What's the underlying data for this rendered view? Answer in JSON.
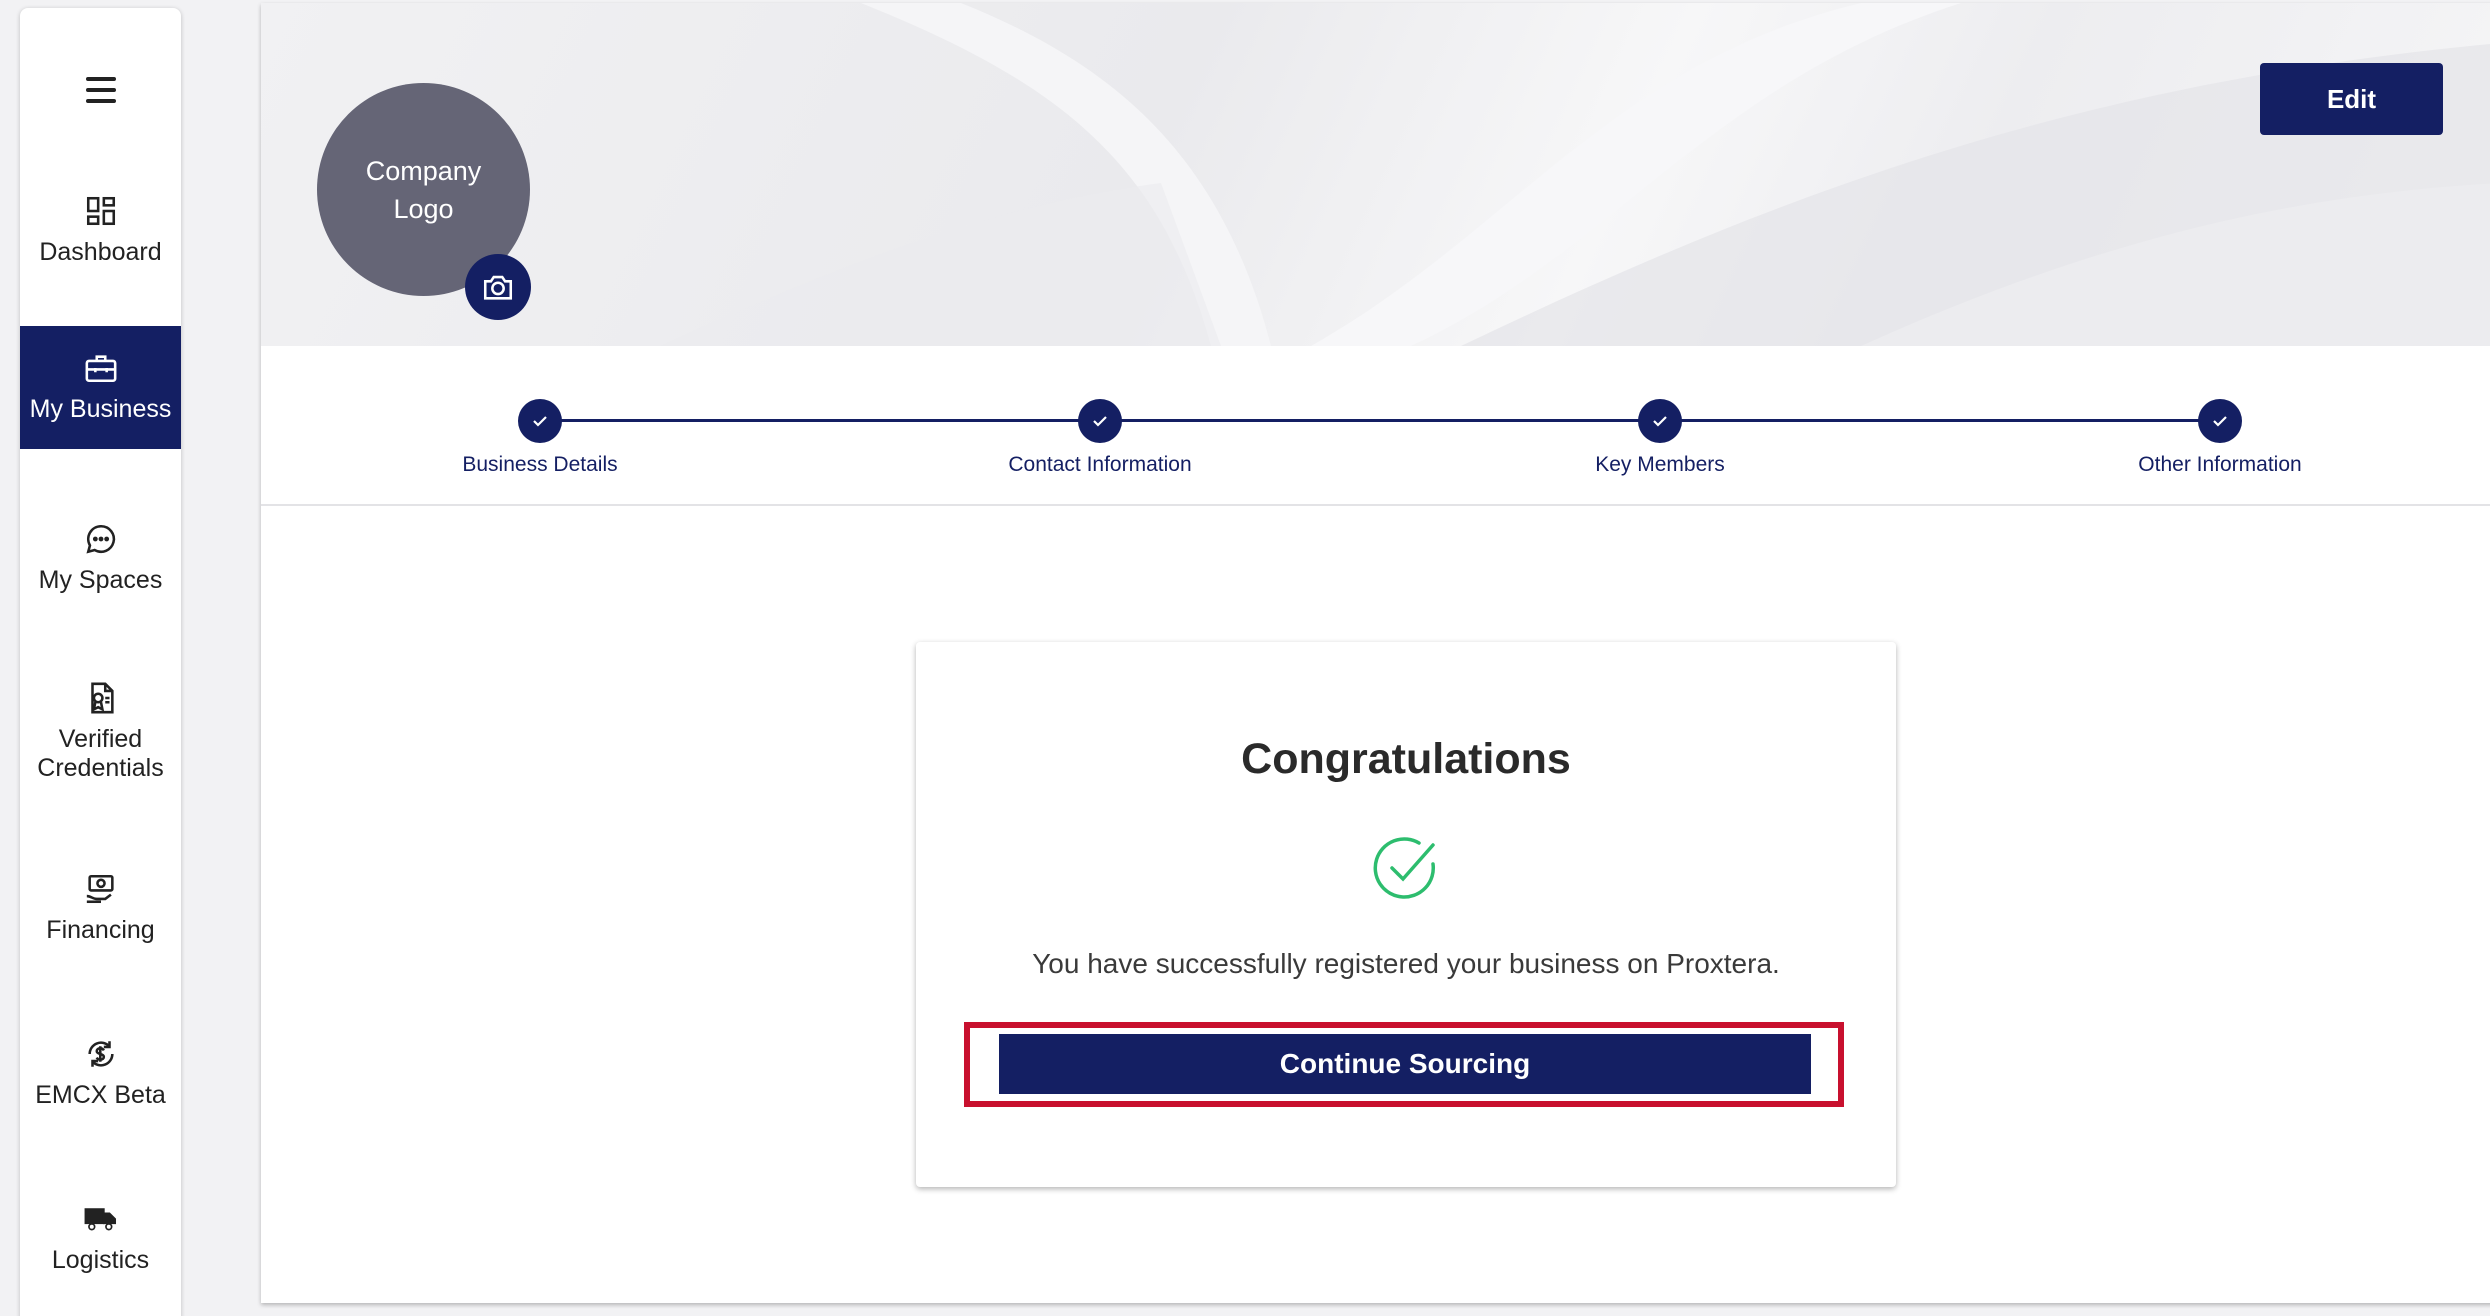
{
  "sidebar": {
    "menu_icon": "hamburger-menu-icon",
    "items": [
      {
        "label": "Dashboard",
        "icon": "dashboard-grid-icon",
        "active": false
      },
      {
        "label": "My Business",
        "icon": "briefcase-icon",
        "active": true
      },
      {
        "label": "My Spaces",
        "icon": "chat-bubble-icon",
        "active": false
      },
      {
        "label": "Verified Credentials",
        "icon": "credential-document-icon",
        "active": false
      },
      {
        "label": "Financing",
        "icon": "financing-money-icon",
        "active": false
      },
      {
        "label": "EMCX Beta",
        "icon": "currency-exchange-icon",
        "active": false
      },
      {
        "label": "Logistics",
        "icon": "truck-icon",
        "active": false
      }
    ]
  },
  "header": {
    "logo_placeholder": "Company Logo",
    "camera_icon": "camera-icon",
    "edit_label": "Edit"
  },
  "stepper": {
    "steps": [
      {
        "label": "Business Details",
        "completed": true
      },
      {
        "label": "Contact Information",
        "completed": true
      },
      {
        "label": "Key Members",
        "completed": true
      },
      {
        "label": "Other Information",
        "completed": true
      }
    ]
  },
  "card": {
    "title": "Congratulations",
    "icon": "success-check-icon",
    "message": "You have successfully registered your business on Proxtera.",
    "button_label": "Continue Sourcing"
  },
  "colors": {
    "primary": "#141f63",
    "highlight": "#c8102e",
    "success": "#2dbd6e",
    "logo_bg": "#656576"
  }
}
